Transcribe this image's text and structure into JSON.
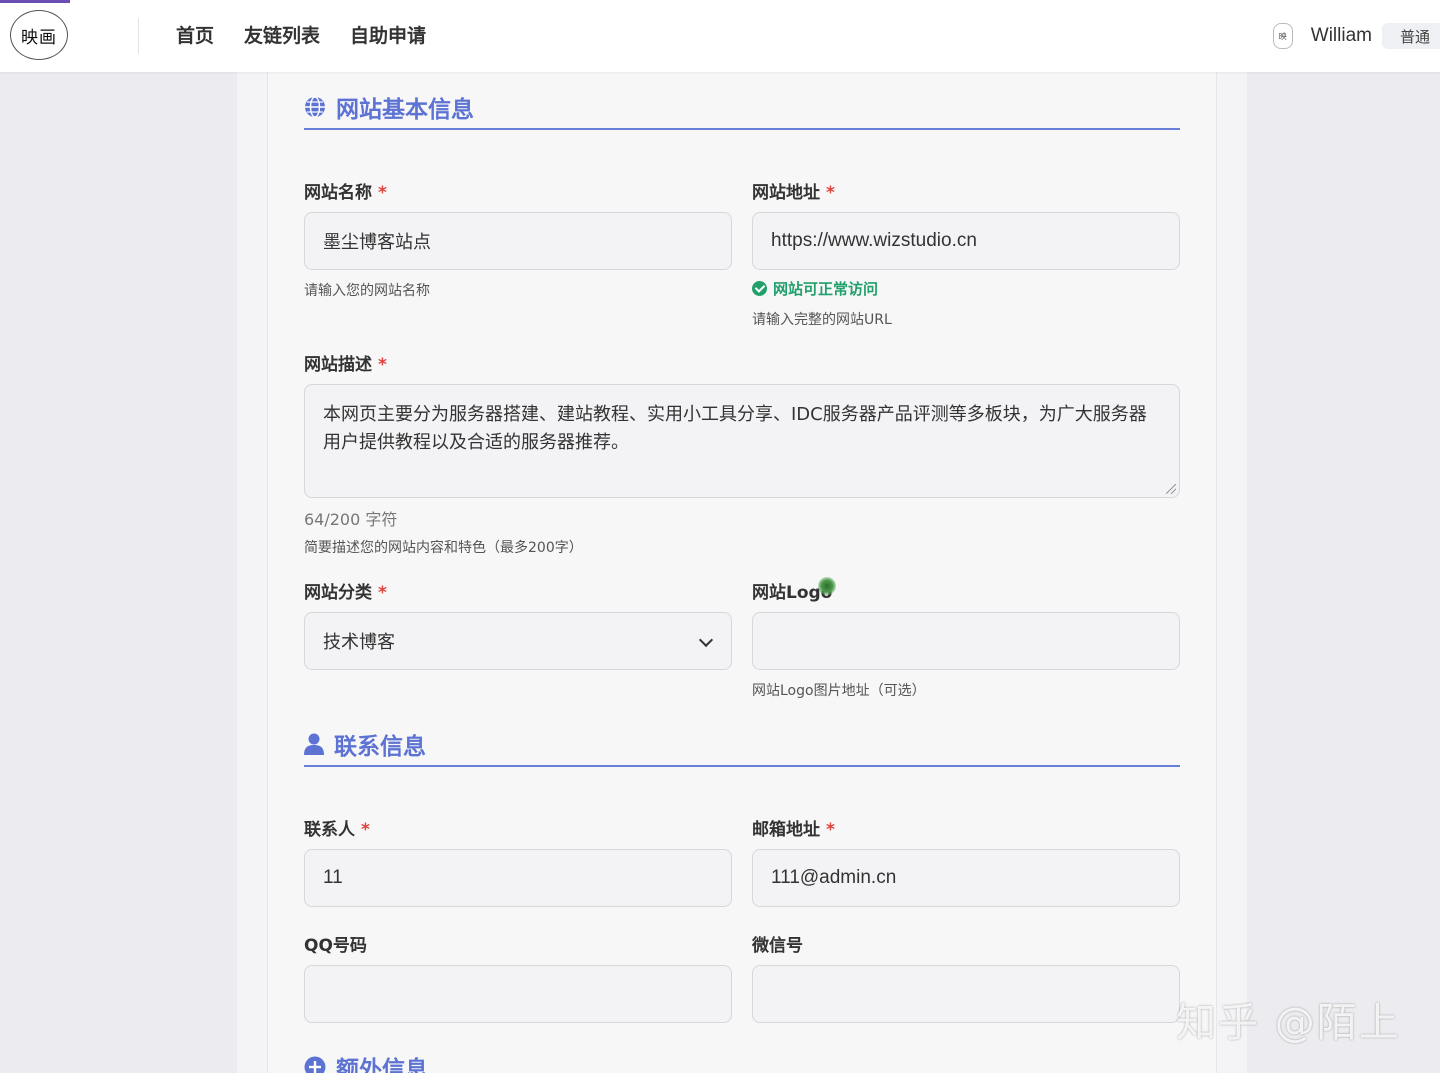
{
  "header": {
    "logo_text": "映画",
    "nav": [
      "首页",
      "友链列表",
      "自助申请"
    ],
    "user_name": "William",
    "user_badge": "普通"
  },
  "sections": {
    "basic": "网站基本信息",
    "contact": "联系信息",
    "extra": "额外信息"
  },
  "fields": {
    "site_name": {
      "label": "网站名称",
      "required": "*",
      "value": "墨尘博客站点",
      "help": "请输入您的网站名称"
    },
    "site_url": {
      "label": "网站地址",
      "required": "*",
      "value": "https://www.wizstudio.cn",
      "status": "网站可正常访问",
      "help": "请输入完整的网站URL"
    },
    "site_desc": {
      "label": "网站描述",
      "required": "*",
      "value": "本网页主要分为服务器搭建、建站教程、实用小工具分享、IDC服务器产品评测等多板块，为广大服务器用户提供教程以及合适的服务器推荐。",
      "count": "64/200 字符",
      "help": "简要描述您的网站内容和特色（最多200字）"
    },
    "site_category": {
      "label": "网站分类",
      "required": "*",
      "value": "技术博客"
    },
    "site_logo": {
      "label": "网站Logo",
      "value": "",
      "help": "网站Logo图片地址（可选）"
    },
    "contact_name": {
      "label": "联系人",
      "required": "*",
      "value": "11"
    },
    "email": {
      "label": "邮箱地址",
      "required": "*",
      "value": "111@admin.cn"
    },
    "qq": {
      "label": "QQ号码",
      "value": ""
    },
    "wechat": {
      "label": "微信号",
      "value": ""
    }
  },
  "watermark": "知乎 @陌上",
  "colors": {
    "accent": "#5d73d4",
    "success": "#22a06b",
    "required": "#e0413a"
  }
}
